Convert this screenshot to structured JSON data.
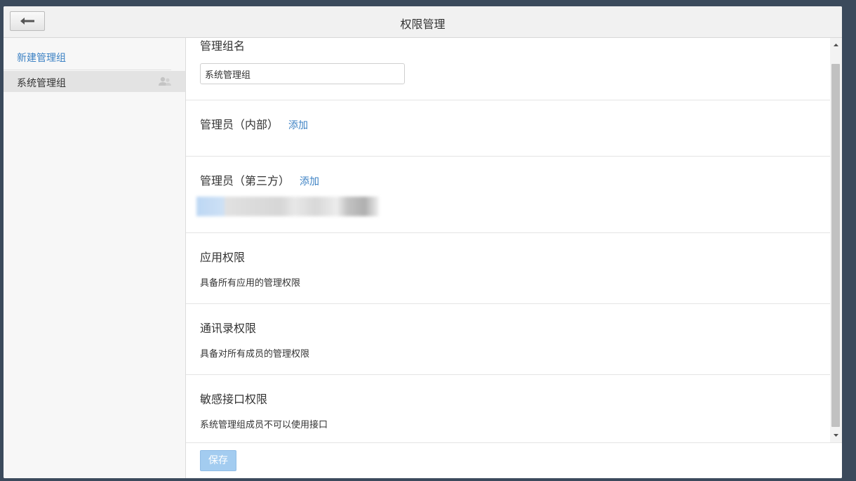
{
  "header": {
    "title": "权限管理",
    "back_icon": "arrow-left-icon"
  },
  "sidebar": {
    "new_group_label": "新建管理组",
    "groups": [
      {
        "label": "系统管理组",
        "icon": "user-group-icon"
      }
    ]
  },
  "main": {
    "group_name": {
      "title": "管理组名",
      "input_value": "系统管理组"
    },
    "admins_internal": {
      "title": "管理员（内部）",
      "add_label": "添加"
    },
    "admins_third_party": {
      "title": "管理员（第三方）",
      "add_label": "添加"
    },
    "app_permission": {
      "title": "应用权限",
      "desc": "具备所有应用的管理权限"
    },
    "contacts_permission": {
      "title": "通讯录权限",
      "desc": "具备对所有成员的管理权限"
    },
    "api_permission": {
      "title": "敏感接口权限",
      "desc": "系统管理组成员不可以使用接口"
    }
  },
  "footer": {
    "save_label": "保存"
  },
  "colors": {
    "accent": "#3d82c4",
    "save_button": "#a3ccf0",
    "background": "#3b4a5c"
  }
}
